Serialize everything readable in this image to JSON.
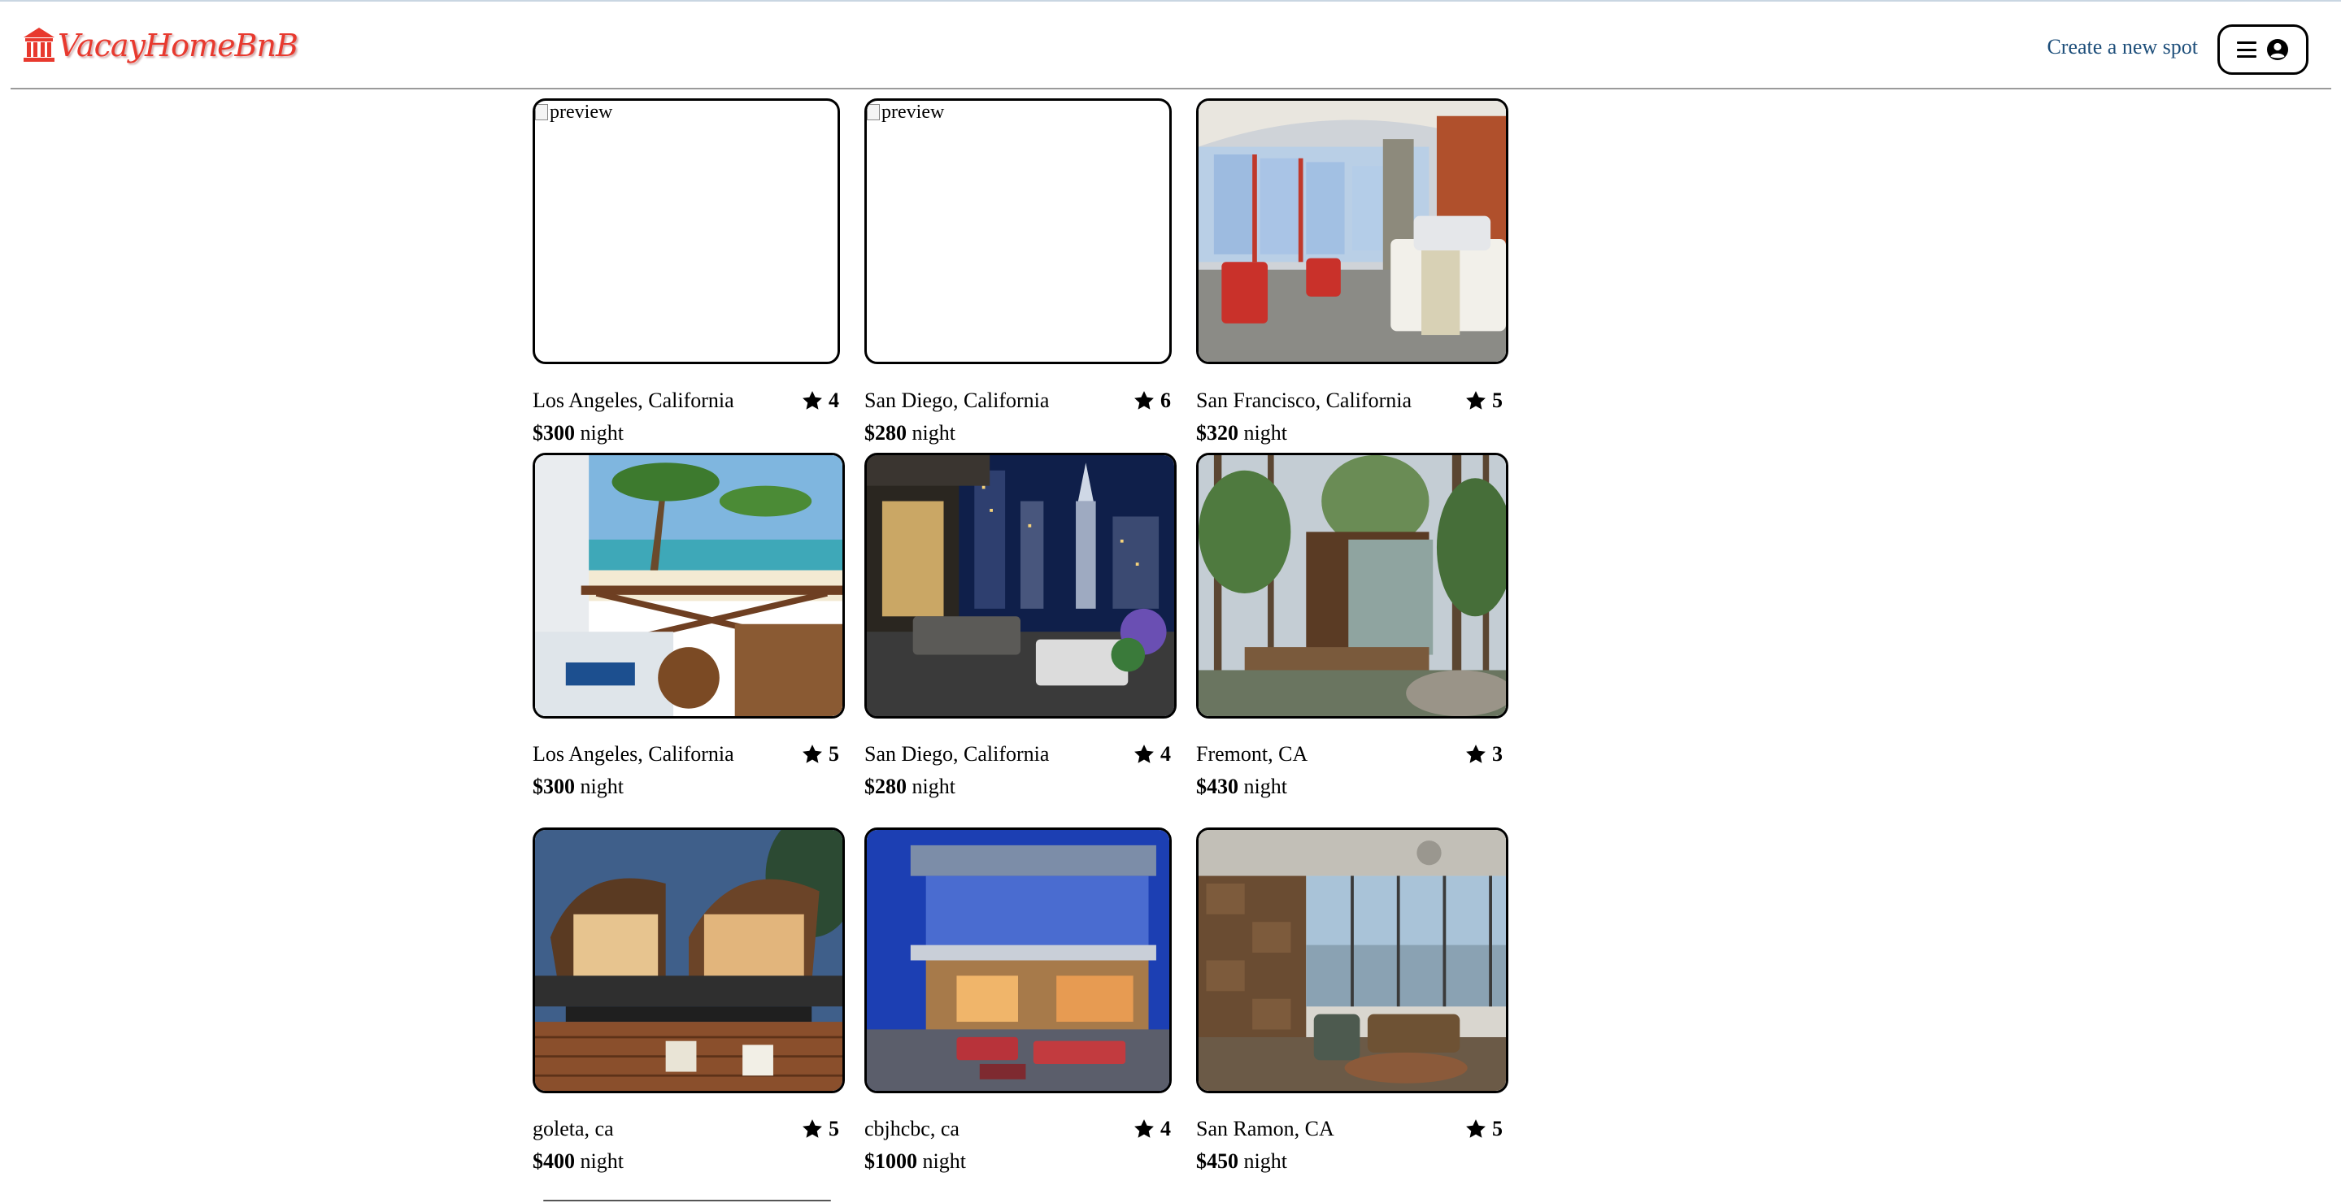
{
  "app": {
    "logo_text": "VacayHomeBnB"
  },
  "header": {
    "create_link": "Create a new spot"
  },
  "spots": [
    {
      "city": "Los Angeles, California",
      "rating": "4",
      "price": "$300",
      "unit": "night",
      "image": "broken",
      "alt": "preview"
    },
    {
      "city": "San Diego, California",
      "rating": "6",
      "price": "$280",
      "unit": "night",
      "image": "broken",
      "alt": "preview"
    },
    {
      "city": "San Francisco, California",
      "rating": "5",
      "price": "$320",
      "unit": "night",
      "image": "hotel-room"
    },
    {
      "city": "Los Angeles, California",
      "rating": "5",
      "price": "$300",
      "unit": "night",
      "image": "beach-balcony"
    },
    {
      "city": "San Diego, California",
      "rating": "4",
      "price": "$280",
      "unit": "night",
      "image": "city-terrace"
    },
    {
      "city": "Fremont, CA",
      "rating": "3",
      "price": "$430",
      "unit": "night",
      "image": "forest-cabin"
    },
    {
      "city": "goleta, ca",
      "rating": "5",
      "price": "$400",
      "unit": "night",
      "image": "tropical-villa"
    },
    {
      "city": "cbjhcbc, ca",
      "rating": "4",
      "price": "$1000",
      "unit": "night",
      "image": "modern-house"
    },
    {
      "city": "San Ramon, CA",
      "rating": "5",
      "price": "$450",
      "unit": "night",
      "image": "loft-view"
    }
  ],
  "colors": {
    "logo": "#e8392e",
    "link": "#1d4e7a"
  },
  "icons": {
    "menu": "hamburger-icon",
    "user": "user-circle-icon",
    "rating": "star-icon"
  }
}
